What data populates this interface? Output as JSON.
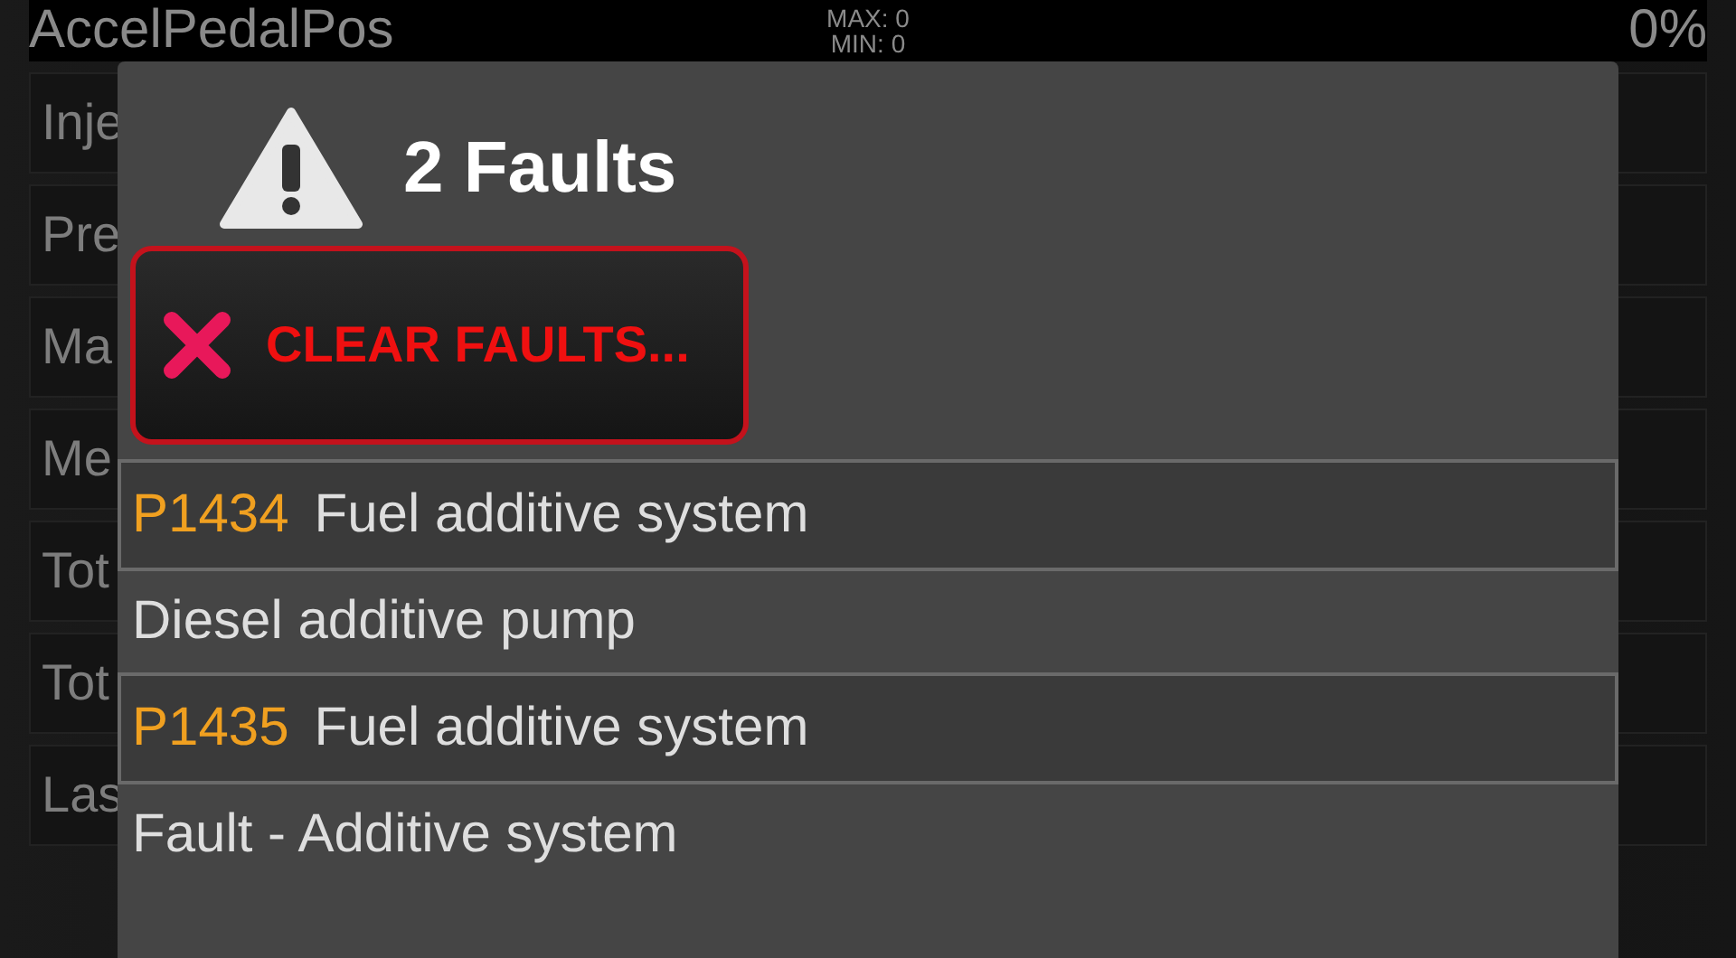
{
  "header": {
    "name": "AccelPedalPos",
    "max": "MAX: 0",
    "min": "MIN: 0",
    "value": "0%"
  },
  "rows": [
    {
      "label": "Inje"
    },
    {
      "label": "Pre"
    },
    {
      "label": "Ma"
    },
    {
      "label": "Me"
    },
    {
      "label": "Tot"
    },
    {
      "label": "Tot"
    },
    {
      "label": "Las"
    }
  ],
  "dialog": {
    "title": "2 Faults",
    "clear_button": "CLEAR FAULTS...",
    "faults": [
      {
        "code": "P1434",
        "name": "Fuel additive system",
        "detail": "Diesel additive pump"
      },
      {
        "code": "P1435",
        "name": "Fuel additive system",
        "detail": "Fault - Additive system"
      }
    ]
  }
}
